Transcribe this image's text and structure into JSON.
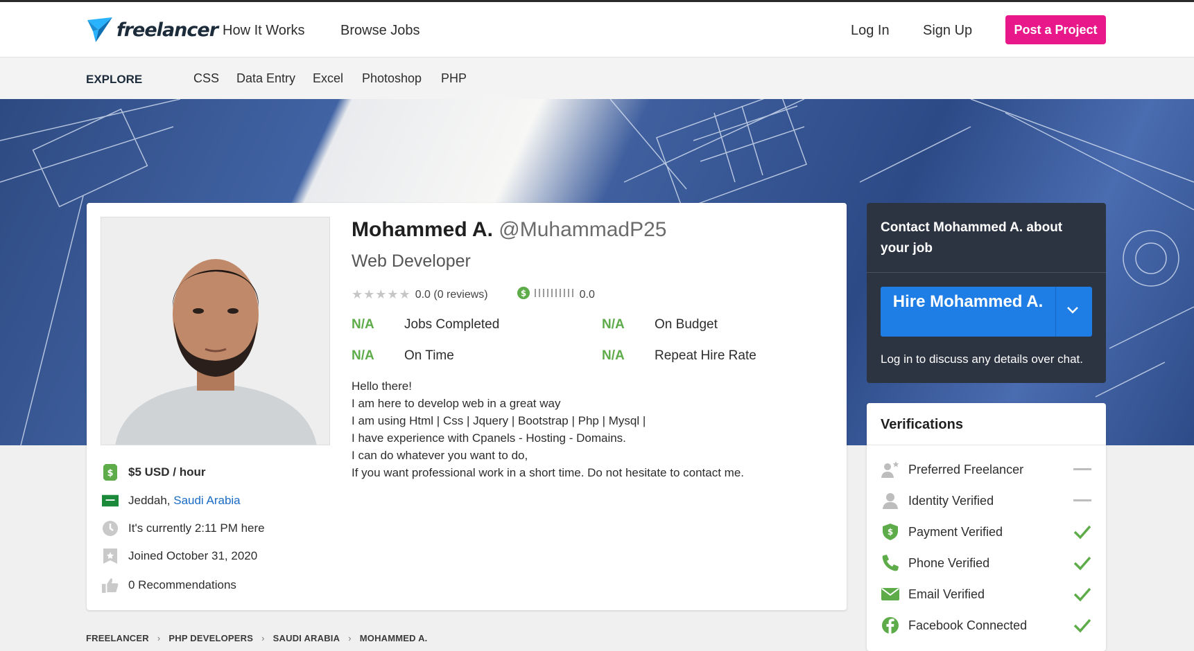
{
  "header": {
    "logo_text": "freelancer",
    "nav": [
      "How It Works",
      "Browse Jobs"
    ],
    "login": "Log In",
    "signup": "Sign Up",
    "post_project": "Post a Project",
    "brand_color": "#e8188a"
  },
  "explore": {
    "label": "EXPLORE",
    "items": [
      "CSS",
      "Data Entry",
      "Excel",
      "Photoshop",
      "PHP"
    ]
  },
  "profile": {
    "name": "Mohammed A.",
    "handle": "@MuhammadP25",
    "title": "Web Developer",
    "rating_text": "0.0 (0 reviews)",
    "earnings_score": "0.0",
    "stats": [
      {
        "value": "N/A",
        "label": "Jobs Completed"
      },
      {
        "value": "N/A",
        "label": "On Budget"
      },
      {
        "value": "N/A",
        "label": "On Time"
      },
      {
        "value": "N/A",
        "label": "Repeat Hire Rate"
      }
    ],
    "bio": [
      "Hello there!",
      "I am here to develop web in a great way",
      "I am using Html | Css | Jquery | Bootstrap | Php | Mysql |",
      "I have experience with Cpanels - Hosting - Domains.",
      "I can do whatever you want to do,",
      "If you want professional work in a short time. Do not hesitate to contact me."
    ],
    "rate": "$5 USD / hour",
    "city": "Jeddah,",
    "country": "Saudi Arabia",
    "local_time": "It's currently 2:11 PM here",
    "joined": "Joined October 31, 2020",
    "recommendations": "0 Recommendations"
  },
  "contact": {
    "title": "Contact Mohammed A. about your job",
    "hire_label": "Hire Mohammed A.",
    "note": "Log in to discuss any details over chat."
  },
  "verifications": {
    "title": "Verifications",
    "items": [
      {
        "label": "Preferred Freelancer",
        "status": "none",
        "icon": "preferred-freelancer-icon"
      },
      {
        "label": "Identity Verified",
        "status": "none",
        "icon": "identity-icon"
      },
      {
        "label": "Payment Verified",
        "status": "verified",
        "icon": "payment-shield-icon"
      },
      {
        "label": "Phone Verified",
        "status": "verified",
        "icon": "phone-icon"
      },
      {
        "label": "Email Verified",
        "status": "verified",
        "icon": "email-icon"
      },
      {
        "label": "Facebook Connected",
        "status": "verified",
        "icon": "facebook-icon"
      }
    ],
    "verified_color": "#5dab49"
  },
  "breadcrumb": [
    "FREELANCER",
    "PHP DEVELOPERS",
    "SAUDI ARABIA",
    "MOHAMMED A."
  ]
}
